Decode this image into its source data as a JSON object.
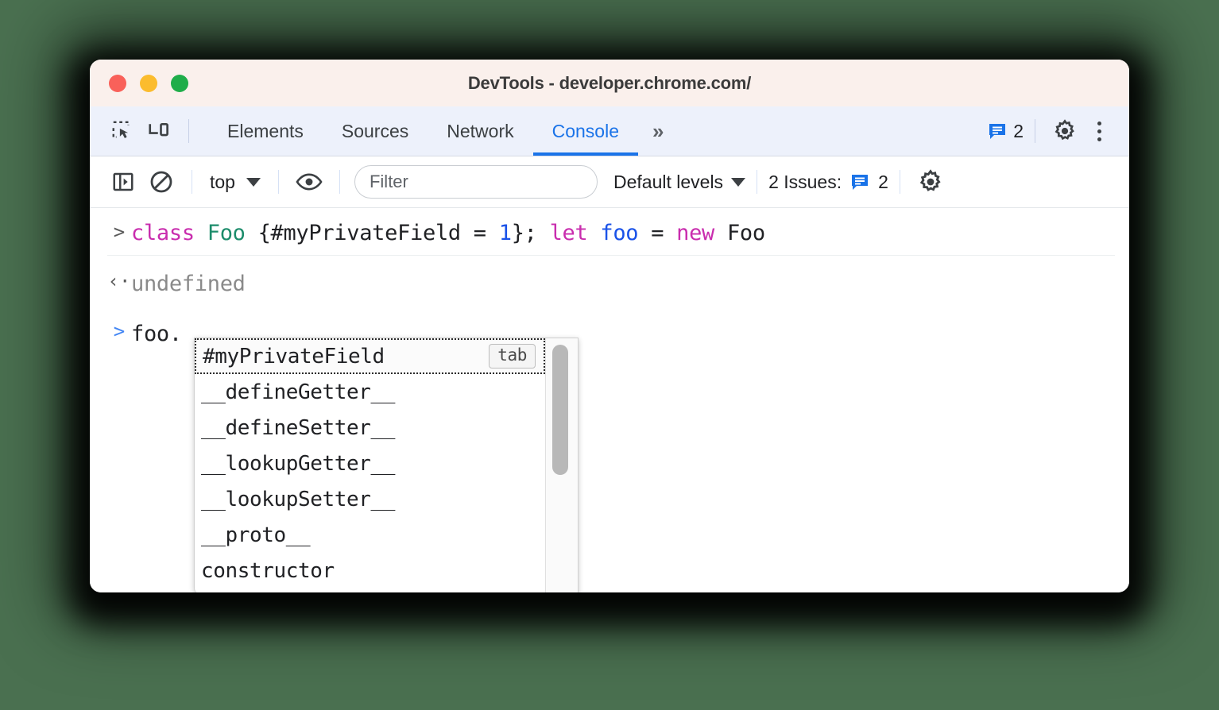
{
  "window": {
    "title": "DevTools - developer.chrome.com/",
    "traffic_lights": [
      {
        "name": "close",
        "color": "#f9615a"
      },
      {
        "name": "minimize",
        "color": "#fbbc2e"
      },
      {
        "name": "maximize",
        "color": "#1fad4a"
      }
    ]
  },
  "tabbar": {
    "inspect_icon": "inspect-element-icon",
    "device_icon": "device-toolbar-icon",
    "tabs": [
      {
        "label": "Elements",
        "active": false
      },
      {
        "label": "Sources",
        "active": false
      },
      {
        "label": "Network",
        "active": false
      },
      {
        "label": "Console",
        "active": true
      }
    ],
    "more_label": "»",
    "issues_count": "2",
    "settings_icon": "gear-icon",
    "menu_icon": "kebab-menu-icon",
    "accent_color": "#1a73e8"
  },
  "console_toolbar": {
    "sidebar_toggle_icon": "show-console-sidebar-icon",
    "clear_icon": "clear-console-icon",
    "context_label": "top",
    "eye_icon": "live-expression-icon",
    "filter_placeholder": "Filter",
    "filter_value": "",
    "levels_label": "Default levels",
    "issues_label": "2 Issues:",
    "issues_count": "2",
    "settings_icon": "gear-icon"
  },
  "console": {
    "lines": [
      {
        "type": "input",
        "gutter": ">",
        "tokens": [
          {
            "text": "class ",
            "cls": "kw"
          },
          {
            "text": "Foo ",
            "cls": "cls"
          },
          {
            "text": "{#myPrivateField = ",
            "cls": "plain"
          },
          {
            "text": "1",
            "cls": "num"
          },
          {
            "text": "}; ",
            "cls": "plain"
          },
          {
            "text": "let ",
            "cls": "kw"
          },
          {
            "text": "foo ",
            "cls": "var"
          },
          {
            "text": "= ",
            "cls": "plain"
          },
          {
            "text": "new ",
            "cls": "kw"
          },
          {
            "text": "Foo",
            "cls": "plain"
          }
        ]
      },
      {
        "type": "output",
        "gutter": "‹·",
        "text": "undefined"
      },
      {
        "type": "prompt",
        "gutter": ">",
        "text": "foo."
      }
    ]
  },
  "autocomplete": {
    "items": [
      {
        "label": "#myPrivateField",
        "selected": true,
        "badge": "tab"
      },
      {
        "label": "__defineGetter__",
        "selected": false,
        "badge": ""
      },
      {
        "label": "__defineSetter__",
        "selected": false,
        "badge": ""
      },
      {
        "label": "__lookupGetter__",
        "selected": false,
        "badge": ""
      },
      {
        "label": "__lookupSetter__",
        "selected": false,
        "badge": ""
      },
      {
        "label": "__proto__",
        "selected": false,
        "badge": ""
      },
      {
        "label": "constructor",
        "selected": false,
        "badge": ""
      }
    ]
  }
}
